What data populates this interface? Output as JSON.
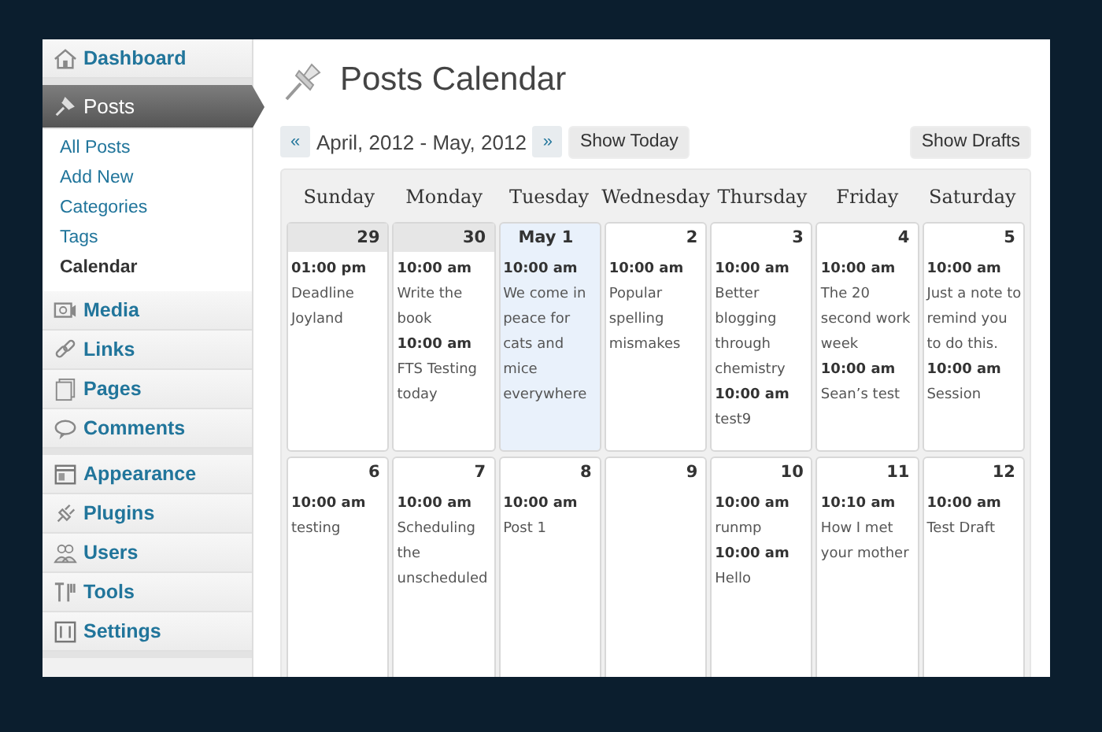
{
  "sidebar": {
    "groups": [
      {
        "items": [
          {
            "label": "Dashboard",
            "selected": false
          }
        ]
      },
      {
        "items": [
          {
            "label": "Posts",
            "selected": true,
            "children": [
              {
                "label": "All Posts",
                "selected": false
              },
              {
                "label": "Add New",
                "selected": false
              },
              {
                "label": "Categories",
                "selected": false
              },
              {
                "label": "Tags",
                "selected": false
              },
              {
                "label": "Calendar",
                "selected": true
              }
            ]
          },
          {
            "label": "Media",
            "selected": false
          },
          {
            "label": "Links",
            "selected": false
          },
          {
            "label": "Pages",
            "selected": false
          },
          {
            "label": "Comments",
            "selected": false
          }
        ]
      },
      {
        "items": [
          {
            "label": "Appearance",
            "selected": false
          },
          {
            "label": "Plugins",
            "selected": false
          },
          {
            "label": "Users",
            "selected": false
          },
          {
            "label": "Tools",
            "selected": false
          },
          {
            "label": "Settings",
            "selected": false
          }
        ]
      }
    ]
  },
  "page": {
    "title": "Posts Calendar"
  },
  "toolbar": {
    "prev": "«",
    "range": "April, 2012 - May, 2012",
    "next": "»",
    "today_button": "Show Today",
    "drafts_button": "Show Drafts"
  },
  "calendar": {
    "weekdays": [
      "Sunday",
      "Monday",
      "Tuesday",
      "Wednesday",
      "Thursday",
      "Friday",
      "Saturday"
    ],
    "weeks": [
      [
        {
          "day": "29",
          "kind": "other",
          "events": [
            {
              "time": "01:00 pm",
              "title": "Deadline Joyland"
            }
          ]
        },
        {
          "day": "30",
          "kind": "other",
          "events": [
            {
              "time": "10:00 am",
              "title": "Write the book"
            },
            {
              "time": "10:00 am",
              "title": "FTS Testing today"
            }
          ]
        },
        {
          "day": "May 1",
          "kind": "today",
          "events": [
            {
              "time": "10:00 am",
              "title": "We come in peace for cats and mice everywhere"
            }
          ]
        },
        {
          "day": "2",
          "kind": "normal",
          "events": [
            {
              "time": "10:00 am",
              "title": "Popular spelling mismakes"
            }
          ]
        },
        {
          "day": "3",
          "kind": "normal",
          "events": [
            {
              "time": "10:00 am",
              "title": "Better blogging through chemistry"
            },
            {
              "time": "10:00 am",
              "title": "test9"
            }
          ]
        },
        {
          "day": "4",
          "kind": "normal",
          "events": [
            {
              "time": "10:00 am",
              "title": "The 20 second work week"
            },
            {
              "time": "10:00 am",
              "title": "Sean’s test"
            }
          ]
        },
        {
          "day": "5",
          "kind": "normal",
          "events": [
            {
              "time": "10:00 am",
              "title": "Just a note to remind you to do this."
            },
            {
              "time": "10:00 am",
              "title": "Session"
            }
          ]
        }
      ],
      [
        {
          "day": "6",
          "kind": "normal",
          "events": [
            {
              "time": "10:00 am",
              "title": "testing"
            }
          ]
        },
        {
          "day": "7",
          "kind": "normal",
          "events": [
            {
              "time": "10:00 am",
              "title": "Scheduling the unscheduled"
            }
          ]
        },
        {
          "day": "8",
          "kind": "normal",
          "events": [
            {
              "time": "10:00 am",
              "title": "Post 1"
            }
          ]
        },
        {
          "day": "9",
          "kind": "normal"
        },
        {
          "day": "10",
          "kind": "normal",
          "events": [
            {
              "time": "10:00 am",
              "title": "runmp"
            },
            {
              "time": "10:00 am",
              "title": "Hello"
            }
          ]
        },
        {
          "day": "11",
          "kind": "normal",
          "events": [
            {
              "time": "10:10 am",
              "title": "How I met your mother"
            }
          ]
        },
        {
          "day": "12",
          "kind": "normal",
          "events": [
            {
              "time": "10:00 am",
              "title": "Test Draft"
            }
          ]
        }
      ]
    ]
  }
}
